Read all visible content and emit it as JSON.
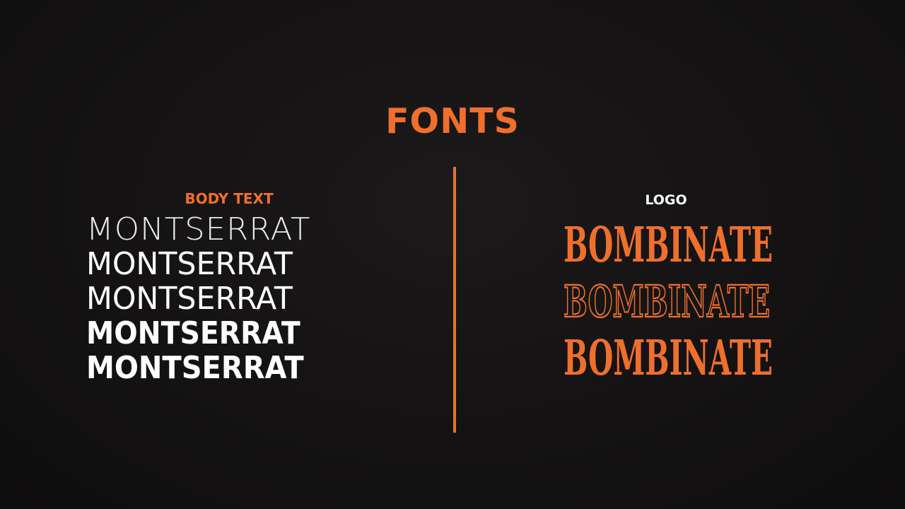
{
  "title": "FONTS",
  "body_text": {
    "label": "BODY TEXT",
    "samples": [
      "MONTSERRAT",
      "MONTSERRAT",
      "MONTSERRAT",
      "MONTSERRAT",
      "MONTSERRAT"
    ]
  },
  "logo": {
    "label": "LOGO",
    "words": [
      "BOMBINATE",
      "BOMBINATE",
      "BOMBINATE"
    ]
  },
  "colors": {
    "accent": "#ef6f2c",
    "background": "#141212",
    "text": "#ffffff"
  }
}
